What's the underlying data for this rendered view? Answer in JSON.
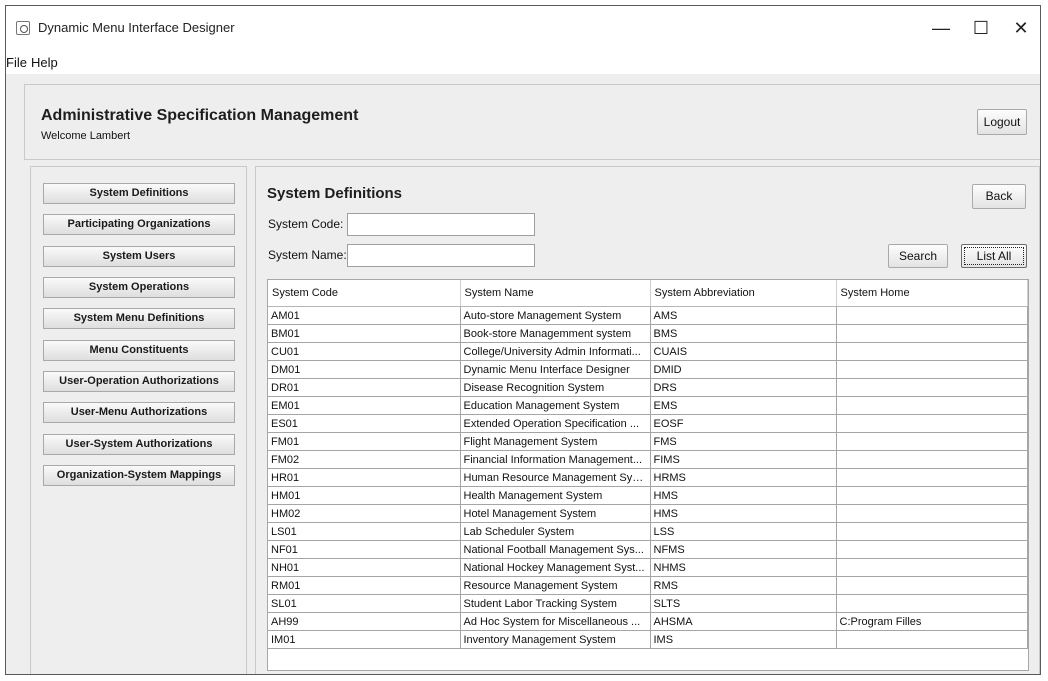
{
  "window": {
    "title": "Dynamic Menu Interface Designer",
    "minimize": "—",
    "maximize": "☐",
    "close": "✕"
  },
  "menu": {
    "file": "File",
    "help": "Help"
  },
  "header": {
    "title": "Administrative Specification Management",
    "welcome": "Welcome Lambert",
    "logout_label": "Logout"
  },
  "sidebar": {
    "items": [
      "System Definitions",
      "Participating Organizations",
      "System Users",
      "System Operations",
      "System Menu Definitions",
      "Menu Constituents",
      "User-Operation Authorizations",
      "User-Menu Authorizations",
      "User-System Authorizations",
      "Organization-System Mappings"
    ]
  },
  "main": {
    "title": "System Definitions",
    "back_label": "Back",
    "code_label": "System Code:",
    "code_value": "",
    "name_label": "System Name:",
    "name_value": "",
    "search_label": "Search",
    "list_all_label": "List All"
  },
  "table": {
    "columns": [
      "System Code",
      "System Name",
      "System Abbreviation",
      "System Home"
    ],
    "rows": [
      [
        "AM01",
        "Auto-store Management System",
        "AMS",
        ""
      ],
      [
        "BM01",
        "Book-store Managemment system",
        "BMS",
        ""
      ],
      [
        "CU01",
        "College/University Admin Informati...",
        "CUAIS",
        ""
      ],
      [
        "DM01",
        "Dynamic Menu Interface Designer",
        "DMID",
        ""
      ],
      [
        "DR01",
        "Disease Recognition System",
        "DRS",
        ""
      ],
      [
        "EM01",
        "Education Management System",
        "EMS",
        ""
      ],
      [
        "ES01",
        "Extended Operation Specification ...",
        "EOSF",
        ""
      ],
      [
        "FM01",
        "Flight Management System",
        "FMS",
        ""
      ],
      [
        "FM02",
        "Financial Information Management...",
        "FIMS",
        ""
      ],
      [
        "HR01",
        "Human Resource Management Sys...",
        "HRMS",
        ""
      ],
      [
        "HM01",
        "Health Management System",
        "HMS",
        ""
      ],
      [
        "HM02",
        "Hotel Management System",
        "HMS",
        ""
      ],
      [
        "LS01",
        "Lab Scheduler System",
        "LSS",
        ""
      ],
      [
        "NF01",
        "National Football Management Sys...",
        "NFMS",
        ""
      ],
      [
        "NH01",
        "National Hockey Management Syst...",
        "NHMS",
        ""
      ],
      [
        "RM01",
        "Resource Management System",
        "RMS",
        ""
      ],
      [
        "SL01",
        "Student Labor Tracking System",
        "SLTS",
        ""
      ],
      [
        "AH99",
        "Ad Hoc System for Miscellaneous ...",
        "AHSMA",
        "C:Program Filles"
      ],
      [
        "IM01",
        "Inventory Management System",
        "IMS",
        ""
      ]
    ]
  }
}
